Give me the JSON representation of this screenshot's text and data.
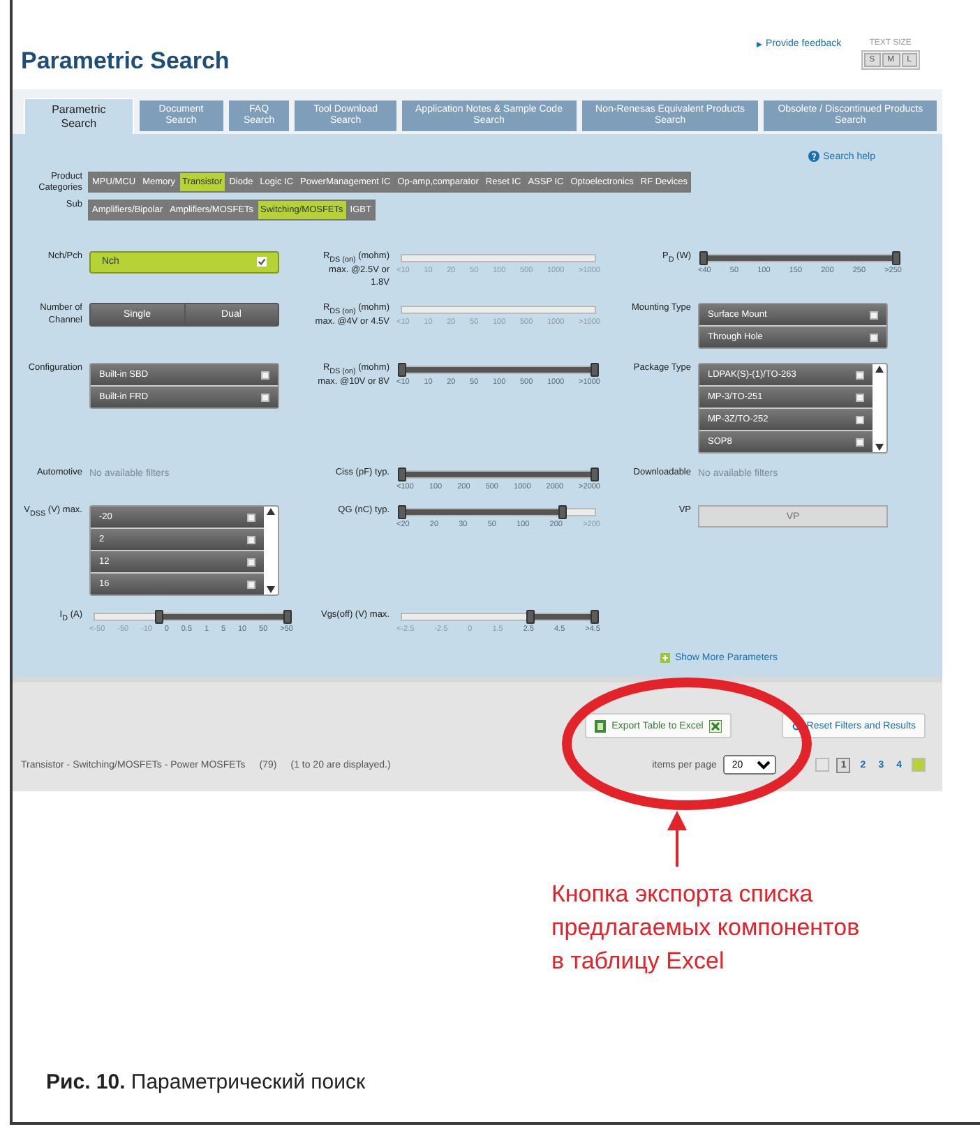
{
  "header": {
    "title": "Parametric Search",
    "feedback_link": "Provide feedback",
    "text_size_label": "TEXT SIZE",
    "text_sizes": [
      "S",
      "M",
      "L"
    ]
  },
  "tabs": [
    {
      "label": "Parametric Search",
      "selected": true
    },
    {
      "label": "Document Search",
      "selected": false
    },
    {
      "label": "FAQ Search",
      "selected": false
    },
    {
      "label": "Tool Download Search",
      "selected": false
    },
    {
      "label": "Application Notes & Sample Code Search",
      "selected": false
    },
    {
      "label": "Non-Renesas Equivalent Products Search",
      "selected": false
    },
    {
      "label": "Obsolete / Discontinued Products Search",
      "selected": false
    }
  ],
  "search_help": "Search help",
  "categories": {
    "label": "Product Categories",
    "items": [
      {
        "label": "MPU/MCU",
        "selected": false
      },
      {
        "label": "Memory",
        "selected": false
      },
      {
        "label": "Transistor",
        "selected": true
      },
      {
        "label": "Diode",
        "selected": false
      },
      {
        "label": "Logic IC",
        "selected": false
      },
      {
        "label": "PowerManagement IC",
        "selected": false
      },
      {
        "label": "Op-amp,comparator",
        "selected": false
      },
      {
        "label": "Reset IC",
        "selected": false
      },
      {
        "label": "ASSP IC",
        "selected": false
      },
      {
        "label": "Optoelectronics",
        "selected": false
      },
      {
        "label": "RF Devices",
        "selected": false
      }
    ]
  },
  "sub": {
    "label": "Sub",
    "items": [
      {
        "label": "Amplifiers/Bipolar",
        "selected": false
      },
      {
        "label": "Amplifiers/MOSFETs",
        "selected": false
      },
      {
        "label": "Switching/MOSFETs",
        "selected": true
      },
      {
        "label": "IGBT",
        "selected": false
      }
    ]
  },
  "filters": [
    {
      "kind": "select",
      "label": "Nch/Pch",
      "value": "Nch",
      "checked": true
    },
    {
      "kind": "slider",
      "label": "R$_{DS (on)}$ (mohm) max. @2.5V or 1.8V",
      "ticks": [
        {
          "label": "<10",
          "selected": false
        },
        {
          "label": "10",
          "selected": false
        },
        {
          "label": "20",
          "selected": false
        },
        {
          "label": "50",
          "selected": false
        },
        {
          "label": "100",
          "selected": false
        },
        {
          "label": "500",
          "selected": false
        },
        {
          "label": "1000",
          "selected": false
        },
        {
          "label": ">1000",
          "selected": false
        }
      ]
    },
    {
      "kind": "slider",
      "label": "P$_{D}$ (W)",
      "ticks": [
        {
          "label": "<40",
          "selected": true
        },
        {
          "label": "50",
          "selected": true
        },
        {
          "label": "100",
          "selected": true
        },
        {
          "label": "150",
          "selected": true
        },
        {
          "label": "200",
          "selected": true
        },
        {
          "label": "250",
          "selected": true
        },
        {
          "label": ">250",
          "selected": true
        }
      ]
    },
    {
      "kind": "segmented",
      "label": "Number of Channel",
      "options": [
        {
          "label": "Single",
          "selected": false
        },
        {
          "label": "Dual",
          "selected": false
        }
      ]
    },
    {
      "kind": "slider",
      "label": "R$_{DS (on)}$ (mohm) max. @4V or 4.5V",
      "ticks": [
        {
          "label": "<10",
          "selected": false
        },
        {
          "label": "10",
          "selected": false
        },
        {
          "label": "20",
          "selected": false
        },
        {
          "label": "50",
          "selected": false
        },
        {
          "label": "100",
          "selected": false
        },
        {
          "label": "500",
          "selected": false
        },
        {
          "label": "1000",
          "selected": false
        },
        {
          "label": ">1000",
          "selected": false
        }
      ]
    },
    {
      "kind": "checklist",
      "label": "Mounting Type",
      "items": [
        {
          "label": "Surface Mount",
          "checked": false
        },
        {
          "label": "Through Hole",
          "checked": false
        }
      ]
    },
    {
      "kind": "checklist",
      "label": "Configuration",
      "items": [
        {
          "label": "Built-in SBD",
          "checked": false
        },
        {
          "label": "Built-in FRD",
          "checked": false
        }
      ]
    },
    {
      "kind": "slider",
      "label": "R$_{DS (on)}$ (mohm) max. @10V or 8V",
      "ticks": [
        {
          "label": "<10",
          "selected": true
        },
        {
          "label": "10",
          "selected": true
        },
        {
          "label": "20",
          "selected": true
        },
        {
          "label": "50",
          "selected": true
        },
        {
          "label": "100",
          "selected": true
        },
        {
          "label": "500",
          "selected": true
        },
        {
          "label": "1000",
          "selected": true
        },
        {
          "label": ">1000",
          "selected": true
        }
      ]
    },
    {
      "kind": "checklist",
      "label": "Package Type",
      "scrollable": true,
      "items": [
        {
          "label": "LDPAK(S)-(1)/TO-263",
          "checked": false
        },
        {
          "label": "MP-3/TO-251",
          "checked": false
        },
        {
          "label": "MP-3Z/TO-252",
          "checked": false
        },
        {
          "label": "SOP8",
          "checked": false
        }
      ]
    },
    {
      "kind": "note",
      "label": "Automotive",
      "text": "No available filters"
    },
    {
      "kind": "slider",
      "label": "Ciss (pF) typ.",
      "ticks": [
        {
          "label": "<100",
          "selected": true
        },
        {
          "label": "100",
          "selected": true
        },
        {
          "label": "200",
          "selected": true
        },
        {
          "label": "500",
          "selected": true
        },
        {
          "label": "1000",
          "selected": true
        },
        {
          "label": "2000",
          "selected": true
        },
        {
          "label": ">2000",
          "selected": true
        }
      ]
    },
    {
      "kind": "note",
      "label": "Downloadable",
      "text": "No available filters"
    },
    {
      "kind": "checklist",
      "label": "V$_{DSS}$ (V) max.",
      "scrollable": true,
      "items": [
        {
          "label": "-20",
          "checked": false
        },
        {
          "label": "2",
          "checked": false
        },
        {
          "label": "12",
          "checked": false
        },
        {
          "label": "16",
          "checked": false
        }
      ]
    },
    {
      "kind": "slider",
      "label": "QG (nC) typ.",
      "ticks": [
        {
          "label": "<20",
          "selected": true
        },
        {
          "label": "20",
          "selected": true
        },
        {
          "label": "30",
          "selected": true
        },
        {
          "label": "50",
          "selected": true
        },
        {
          "label": "100",
          "selected": true
        },
        {
          "label": "200",
          "selected": true
        },
        {
          "label": ">200",
          "selected": false
        }
      ]
    },
    {
      "kind": "field",
      "label": "VP",
      "placeholder": "VP",
      "disabled": true
    },
    {
      "kind": "slider",
      "label": "I$_{D}$ (A)",
      "ticks": [
        {
          "label": "<-50",
          "selected": false
        },
        {
          "label": "-50",
          "selected": false
        },
        {
          "label": "-10",
          "selected": false
        },
        {
          "label": "0",
          "selected": true
        },
        {
          "label": "0.5",
          "selected": true
        },
        {
          "label": "1",
          "selected": true
        },
        {
          "label": "5",
          "selected": true
        },
        {
          "label": "10",
          "selected": true
        },
        {
          "label": "50",
          "selected": true
        },
        {
          "label": ">50",
          "selected": true
        }
      ]
    },
    {
      "kind": "slider",
      "label": "Vgs(off) (V) max.",
      "ticks": [
        {
          "label": "<-2.5",
          "selected": false
        },
        {
          "label": "-2.5",
          "selected": false
        },
        {
          "label": "0",
          "selected": false
        },
        {
          "label": "1.5",
          "selected": false
        },
        {
          "label": "2.5",
          "selected": true
        },
        {
          "label": "4.5",
          "selected": true
        },
        {
          "label": ">4.5",
          "selected": true
        }
      ]
    }
  ],
  "show_more": "Show More Parameters",
  "results": {
    "export_button": "Export Table to Excel",
    "reset_button": "Reset Filters and Results",
    "summary": [
      "Transistor - Switching/MOSFETs - Power MOSFETs",
      "(79)",
      "(1 to 20 are displayed.)"
    ],
    "items_per_page_label": "items per page",
    "items_per_page": "20",
    "pages": [
      {
        "label": "1",
        "selected": true
      },
      {
        "label": "2",
        "selected": false
      },
      {
        "label": "3",
        "selected": false
      },
      {
        "label": "4",
        "selected": false
      }
    ]
  },
  "annotation": {
    "text": "Кнопка экспорта списка предлагаемых компонентов в таблицу Excel"
  },
  "caption": "**Рис. 10.** Параметрический поиск"
}
